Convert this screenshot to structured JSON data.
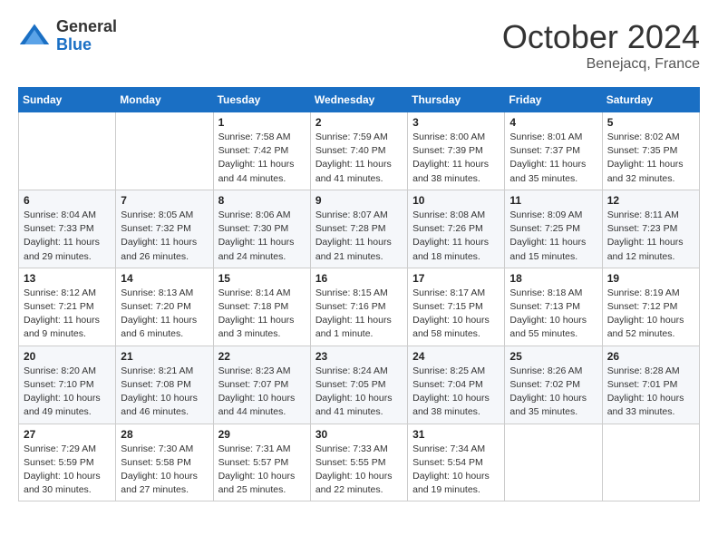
{
  "header": {
    "logo": {
      "general": "General",
      "blue": "Blue"
    },
    "title": "October 2024",
    "subtitle": "Benejacq, France"
  },
  "calendar": {
    "weekdays": [
      "Sunday",
      "Monday",
      "Tuesday",
      "Wednesday",
      "Thursday",
      "Friday",
      "Saturday"
    ],
    "weeks": [
      [
        {
          "day": null,
          "info": null
        },
        {
          "day": null,
          "info": null
        },
        {
          "day": "1",
          "sunrise": "7:58 AM",
          "sunset": "7:42 PM",
          "daylight": "11 hours and 44 minutes."
        },
        {
          "day": "2",
          "sunrise": "7:59 AM",
          "sunset": "7:40 PM",
          "daylight": "11 hours and 41 minutes."
        },
        {
          "day": "3",
          "sunrise": "8:00 AM",
          "sunset": "7:39 PM",
          "daylight": "11 hours and 38 minutes."
        },
        {
          "day": "4",
          "sunrise": "8:01 AM",
          "sunset": "7:37 PM",
          "daylight": "11 hours and 35 minutes."
        },
        {
          "day": "5",
          "sunrise": "8:02 AM",
          "sunset": "7:35 PM",
          "daylight": "11 hours and 32 minutes."
        }
      ],
      [
        {
          "day": "6",
          "sunrise": "8:04 AM",
          "sunset": "7:33 PM",
          "daylight": "11 hours and 29 minutes."
        },
        {
          "day": "7",
          "sunrise": "8:05 AM",
          "sunset": "7:32 PM",
          "daylight": "11 hours and 26 minutes."
        },
        {
          "day": "8",
          "sunrise": "8:06 AM",
          "sunset": "7:30 PM",
          "daylight": "11 hours and 24 minutes."
        },
        {
          "day": "9",
          "sunrise": "8:07 AM",
          "sunset": "7:28 PM",
          "daylight": "11 hours and 21 minutes."
        },
        {
          "day": "10",
          "sunrise": "8:08 AM",
          "sunset": "7:26 PM",
          "daylight": "11 hours and 18 minutes."
        },
        {
          "day": "11",
          "sunrise": "8:09 AM",
          "sunset": "7:25 PM",
          "daylight": "11 hours and 15 minutes."
        },
        {
          "day": "12",
          "sunrise": "8:11 AM",
          "sunset": "7:23 PM",
          "daylight": "11 hours and 12 minutes."
        }
      ],
      [
        {
          "day": "13",
          "sunrise": "8:12 AM",
          "sunset": "7:21 PM",
          "daylight": "11 hours and 9 minutes."
        },
        {
          "day": "14",
          "sunrise": "8:13 AM",
          "sunset": "7:20 PM",
          "daylight": "11 hours and 6 minutes."
        },
        {
          "day": "15",
          "sunrise": "8:14 AM",
          "sunset": "7:18 PM",
          "daylight": "11 hours and 3 minutes."
        },
        {
          "day": "16",
          "sunrise": "8:15 AM",
          "sunset": "7:16 PM",
          "daylight": "11 hours and 1 minute."
        },
        {
          "day": "17",
          "sunrise": "8:17 AM",
          "sunset": "7:15 PM",
          "daylight": "10 hours and 58 minutes."
        },
        {
          "day": "18",
          "sunrise": "8:18 AM",
          "sunset": "7:13 PM",
          "daylight": "10 hours and 55 minutes."
        },
        {
          "day": "19",
          "sunrise": "8:19 AM",
          "sunset": "7:12 PM",
          "daylight": "10 hours and 52 minutes."
        }
      ],
      [
        {
          "day": "20",
          "sunrise": "8:20 AM",
          "sunset": "7:10 PM",
          "daylight": "10 hours and 49 minutes."
        },
        {
          "day": "21",
          "sunrise": "8:21 AM",
          "sunset": "7:08 PM",
          "daylight": "10 hours and 46 minutes."
        },
        {
          "day": "22",
          "sunrise": "8:23 AM",
          "sunset": "7:07 PM",
          "daylight": "10 hours and 44 minutes."
        },
        {
          "day": "23",
          "sunrise": "8:24 AM",
          "sunset": "7:05 PM",
          "daylight": "10 hours and 41 minutes."
        },
        {
          "day": "24",
          "sunrise": "8:25 AM",
          "sunset": "7:04 PM",
          "daylight": "10 hours and 38 minutes."
        },
        {
          "day": "25",
          "sunrise": "8:26 AM",
          "sunset": "7:02 PM",
          "daylight": "10 hours and 35 minutes."
        },
        {
          "day": "26",
          "sunrise": "8:28 AM",
          "sunset": "7:01 PM",
          "daylight": "10 hours and 33 minutes."
        }
      ],
      [
        {
          "day": "27",
          "sunrise": "7:29 AM",
          "sunset": "5:59 PM",
          "daylight": "10 hours and 30 minutes."
        },
        {
          "day": "28",
          "sunrise": "7:30 AM",
          "sunset": "5:58 PM",
          "daylight": "10 hours and 27 minutes."
        },
        {
          "day": "29",
          "sunrise": "7:31 AM",
          "sunset": "5:57 PM",
          "daylight": "10 hours and 25 minutes."
        },
        {
          "day": "30",
          "sunrise": "7:33 AM",
          "sunset": "5:55 PM",
          "daylight": "10 hours and 22 minutes."
        },
        {
          "day": "31",
          "sunrise": "7:34 AM",
          "sunset": "5:54 PM",
          "daylight": "10 hours and 19 minutes."
        },
        {
          "day": null,
          "info": null
        },
        {
          "day": null,
          "info": null
        }
      ]
    ]
  }
}
